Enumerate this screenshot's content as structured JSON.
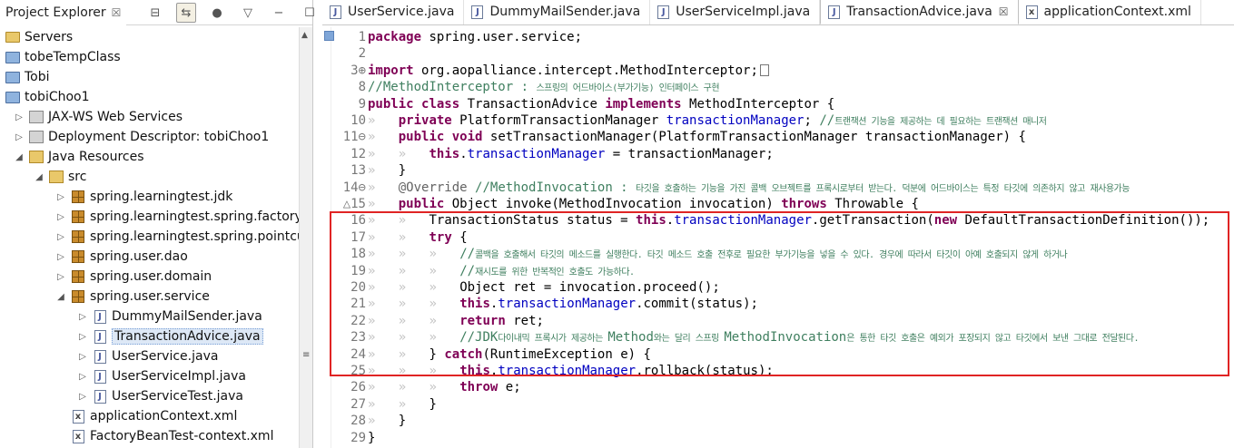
{
  "explorer": {
    "title": "Project Explorer",
    "close": "☒",
    "tree": [
      {
        "label": "Servers",
        "icon": "folder",
        "depth": 0,
        "arrow": ""
      },
      {
        "label": "tobeTempClass",
        "icon": "project",
        "depth": 0,
        "arrow": ""
      },
      {
        "label": "Tobi",
        "icon": "project",
        "depth": 0,
        "arrow": ""
      },
      {
        "label": "tobiChoo1",
        "icon": "web-project",
        "depth": 0,
        "arrow": ""
      },
      {
        "label": "JAX-WS Web Services",
        "icon": "misc",
        "depth": 1,
        "arrow": "▷"
      },
      {
        "label": "Deployment Descriptor: tobiChoo1",
        "icon": "misc",
        "depth": 1,
        "arrow": "▷"
      },
      {
        "label": "Java Resources",
        "icon": "src",
        "depth": 1,
        "arrow": "◢"
      },
      {
        "label": "src",
        "icon": "src",
        "depth": 2,
        "arrow": "◢"
      },
      {
        "label": "spring.learningtest.jdk",
        "icon": "package",
        "depth": 3,
        "arrow": "▷"
      },
      {
        "label": "spring.learningtest.spring.factoryb",
        "icon": "package",
        "depth": 3,
        "arrow": "▷"
      },
      {
        "label": "spring.learningtest.spring.pointcut",
        "icon": "package",
        "depth": 3,
        "arrow": "▷"
      },
      {
        "label": "spring.user.dao",
        "icon": "package",
        "depth": 3,
        "arrow": "▷"
      },
      {
        "label": "spring.user.domain",
        "icon": "package",
        "depth": 3,
        "arrow": "▷"
      },
      {
        "label": "spring.user.service",
        "icon": "package",
        "depth": 3,
        "arrow": "◢"
      },
      {
        "label": "DummyMailSender.java",
        "icon": "java",
        "depth": 4,
        "arrow": "▷"
      },
      {
        "label": "TransactionAdvice.java",
        "icon": "java",
        "depth": 4,
        "arrow": "▷",
        "selected": true
      },
      {
        "label": "UserService.java",
        "icon": "java",
        "depth": 4,
        "arrow": "▷"
      },
      {
        "label": "UserServiceImpl.java",
        "icon": "java",
        "depth": 4,
        "arrow": "▷"
      },
      {
        "label": "UserServiceTest.java",
        "icon": "java",
        "depth": 4,
        "arrow": "▷"
      },
      {
        "label": "applicationContext.xml",
        "icon": "xml",
        "depth": 3,
        "arrow": ""
      },
      {
        "label": "FactoryBeanTest-context.xml",
        "icon": "xml",
        "depth": 3,
        "arrow": ""
      }
    ]
  },
  "editor": {
    "tabs": [
      {
        "label": "UserService.java",
        "icon": "J",
        "active": false
      },
      {
        "label": "DummyMailSender.java",
        "icon": "J",
        "active": false
      },
      {
        "label": "UserServiceImpl.java",
        "icon": "J",
        "active": false
      },
      {
        "label": "TransactionAdvice.java",
        "icon": "J",
        "active": true,
        "close": "☒"
      },
      {
        "label": "applicationContext.xml",
        "icon": "x",
        "active": false
      }
    ],
    "lines": [
      {
        "n": "1",
        "html": "<span class=\"kw\">package</span> spring.user.service;"
      },
      {
        "n": "2",
        "html": ""
      },
      {
        "n": "3⊕",
        "html": "<span class=\"kw\">import</span> org.aopalliance.intercept.MethodInterceptor;<span class=\"hint-box\"></span>"
      },
      {
        "n": "8",
        "html": "<span class=\"cmt\">//MethodInterceptor : <span class=\"kr\">스프링의 어드바이스(부가기능) 인터페이스 구현</span></span>"
      },
      {
        "n": "9",
        "html": "<span class=\"kw\">public</span> <span class=\"kw\">class</span> TransactionAdvice <span class=\"kw\">implements</span> MethodInterceptor {"
      },
      {
        "n": "10",
        "html": "<span class=\"ws\">»</span>   <span class=\"kw\">private</span> PlatformTransactionManager <span class=\"fld\">transactionManager</span>; <span class=\"cmt\">//<span class=\"kr\">트랜잭션 기능을 제공하는 데 필요하는 트랜잭션 매니저</span></span>"
      },
      {
        "n": "11⊖",
        "html": "<span class=\"ws\">»</span>   <span class=\"kw\">public</span> <span class=\"kw\">void</span> setTransactionManager(PlatformTransactionManager transactionManager) {"
      },
      {
        "n": "12",
        "html": "<span class=\"ws\">»</span>   <span class=\"ws\">»</span>   <span class=\"kw\">this</span>.<span class=\"fld\">transactionManager</span> = transactionManager;"
      },
      {
        "n": "13",
        "html": "<span class=\"ws\">»</span>   }"
      },
      {
        "n": "14⊖",
        "html": "<span class=\"ws\">»</span>   <span class=\"ann\">@Override</span> <span class=\"cmt\">//MethodInvocation : <span class=\"kr\">타깃을 호출하는 기능을 가진 콜백 오브젝트를 프록시로부터 받는다. 덕분에 어드바이스는 특정 타깃에 의존하지 않고 재사용가능</span></span>"
      },
      {
        "n": "△15",
        "html": "<span class=\"ws\">»</span>   <span class=\"kw\">public</span> Object invoke(MethodInvocation invocation) <span class=\"kw\">throws</span> Throwable {"
      },
      {
        "n": "16",
        "html": "<span class=\"ws\">»</span>   <span class=\"ws\">»</span>   TransactionStatus status = <span class=\"kw\">this</span>.<span class=\"fld\">transactionManager</span>.getTransaction(<span class=\"kw\">new</span> DefaultTransactionDefinition());"
      },
      {
        "n": "17",
        "html": "<span class=\"ws\">»</span>   <span class=\"ws\">»</span>   <span class=\"kw\">try</span> {"
      },
      {
        "n": "18",
        "html": "<span class=\"ws\">»</span>   <span class=\"ws\">»</span>   <span class=\"ws\">»</span>   <span class=\"cmt\">//<span class=\"kr\">콜백을 호출해서 타깃의 메소드를 실행한다. 타깃 메소드 호출 전후로 필요한 부가기능을 넣을 수 있다. 경우에 따라서 타깃이 아예 호출되지 않게 하거나</span></span>"
      },
      {
        "n": "19",
        "html": "<span class=\"ws\">»</span>   <span class=\"ws\">»</span>   <span class=\"ws\">»</span>   <span class=\"cmt\">//<span class=\"kr\">재시도를 위한 반복적인 호출도 가능하다.</span></span>"
      },
      {
        "n": "20",
        "html": "<span class=\"ws\">»</span>   <span class=\"ws\">»</span>   <span class=\"ws\">»</span>   Object ret = invocation.proceed();"
      },
      {
        "n": "21",
        "html": "<span class=\"ws\">»</span>   <span class=\"ws\">»</span>   <span class=\"ws\">»</span>   <span class=\"kw\">this</span>.<span class=\"fld\">transactionManager</span>.commit(status);"
      },
      {
        "n": "22",
        "html": "<span class=\"ws\">»</span>   <span class=\"ws\">»</span>   <span class=\"ws\">»</span>   <span class=\"kw\">return</span> ret;"
      },
      {
        "n": "23",
        "html": "<span class=\"ws\">»</span>   <span class=\"ws\">»</span>   <span class=\"ws\">»</span>   <span class=\"cmt\">//JDK<span class=\"kr\">다이내믹 프록시가 제공하는 </span>Method<span class=\"kr\">와는 달리 스프링 </span>MethodInvocation<span class=\"kr\">은 통한 타깃 호출은 예외가 포장되지 않고 타깃에서 보낸 그대로 전달된다.</span></span>"
      },
      {
        "n": "24",
        "html": "<span class=\"ws\">»</span>   <span class=\"ws\">»</span>   } <span class=\"kw\">catch</span>(RuntimeException e) {"
      },
      {
        "n": "25",
        "html": "<span class=\"ws\">»</span>   <span class=\"ws\">»</span>   <span class=\"ws\">»</span>   <span class=\"kw\">this</span>.<span class=\"fld\">transactionManager</span>.rollback(status);"
      },
      {
        "n": "26",
        "html": "<span class=\"ws\">»</span>   <span class=\"ws\">»</span>   <span class=\"ws\">»</span>   <span class=\"kw\">throw</span> e;"
      },
      {
        "n": "27",
        "html": "<span class=\"ws\">»</span>   <span class=\"ws\">»</span>   }"
      },
      {
        "n": "28",
        "html": "<span class=\"ws\">»</span>   }"
      },
      {
        "n": "29",
        "html": "}"
      }
    ]
  }
}
